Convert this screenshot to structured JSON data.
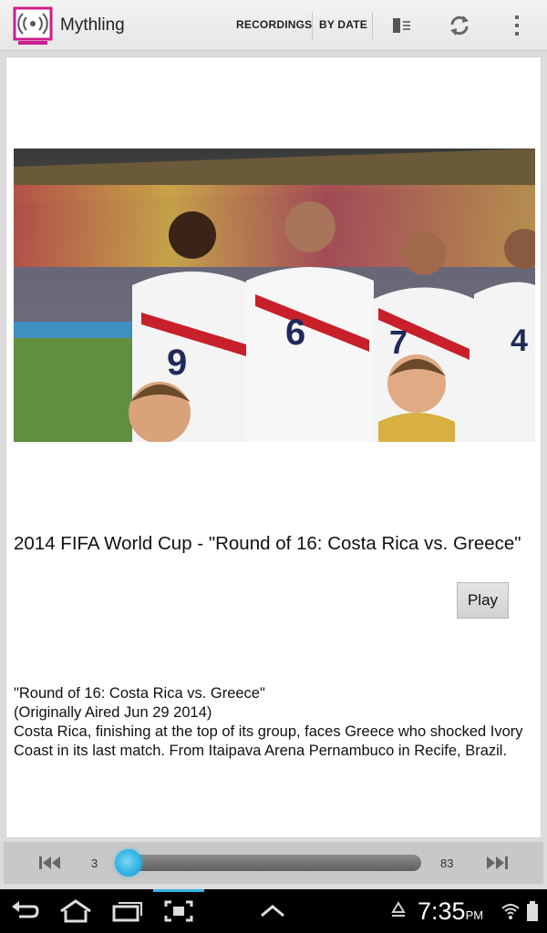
{
  "actionbar": {
    "app_title": "Mythling",
    "tabs": [
      {
        "label": "RECORDINGS"
      },
      {
        "label": "BY DATE"
      }
    ],
    "icons": [
      "app-logo",
      "split-pane-icon",
      "refresh-icon",
      "overflow-menu-icon"
    ]
  },
  "recording": {
    "title": "2014 FIFA World Cup - \"Round of 16: Costa Rica vs. Greece\"",
    "play_label": "Play",
    "description_lines": [
      "\"Round of 16: Costa Rica vs. Greece\"",
      "(Originally Aired Jun 29 2014)",
      "Costa Rica, finishing at the top of its group, faces Greece who shocked Ivory Coast in its last match. From Itaipava Arena Pernambuco in Recife, Brazil."
    ],
    "thumbnail_jersey_numbers": [
      "9",
      "6",
      "7",
      "4"
    ]
  },
  "seekbar": {
    "current": "3",
    "total": "83",
    "progress_fraction": 0.0
  },
  "systembar": {
    "time": "7:35",
    "ampm": "PM"
  },
  "colors": {
    "accent": "#33b5e5",
    "logo_magenta": "#cc1f8f"
  }
}
